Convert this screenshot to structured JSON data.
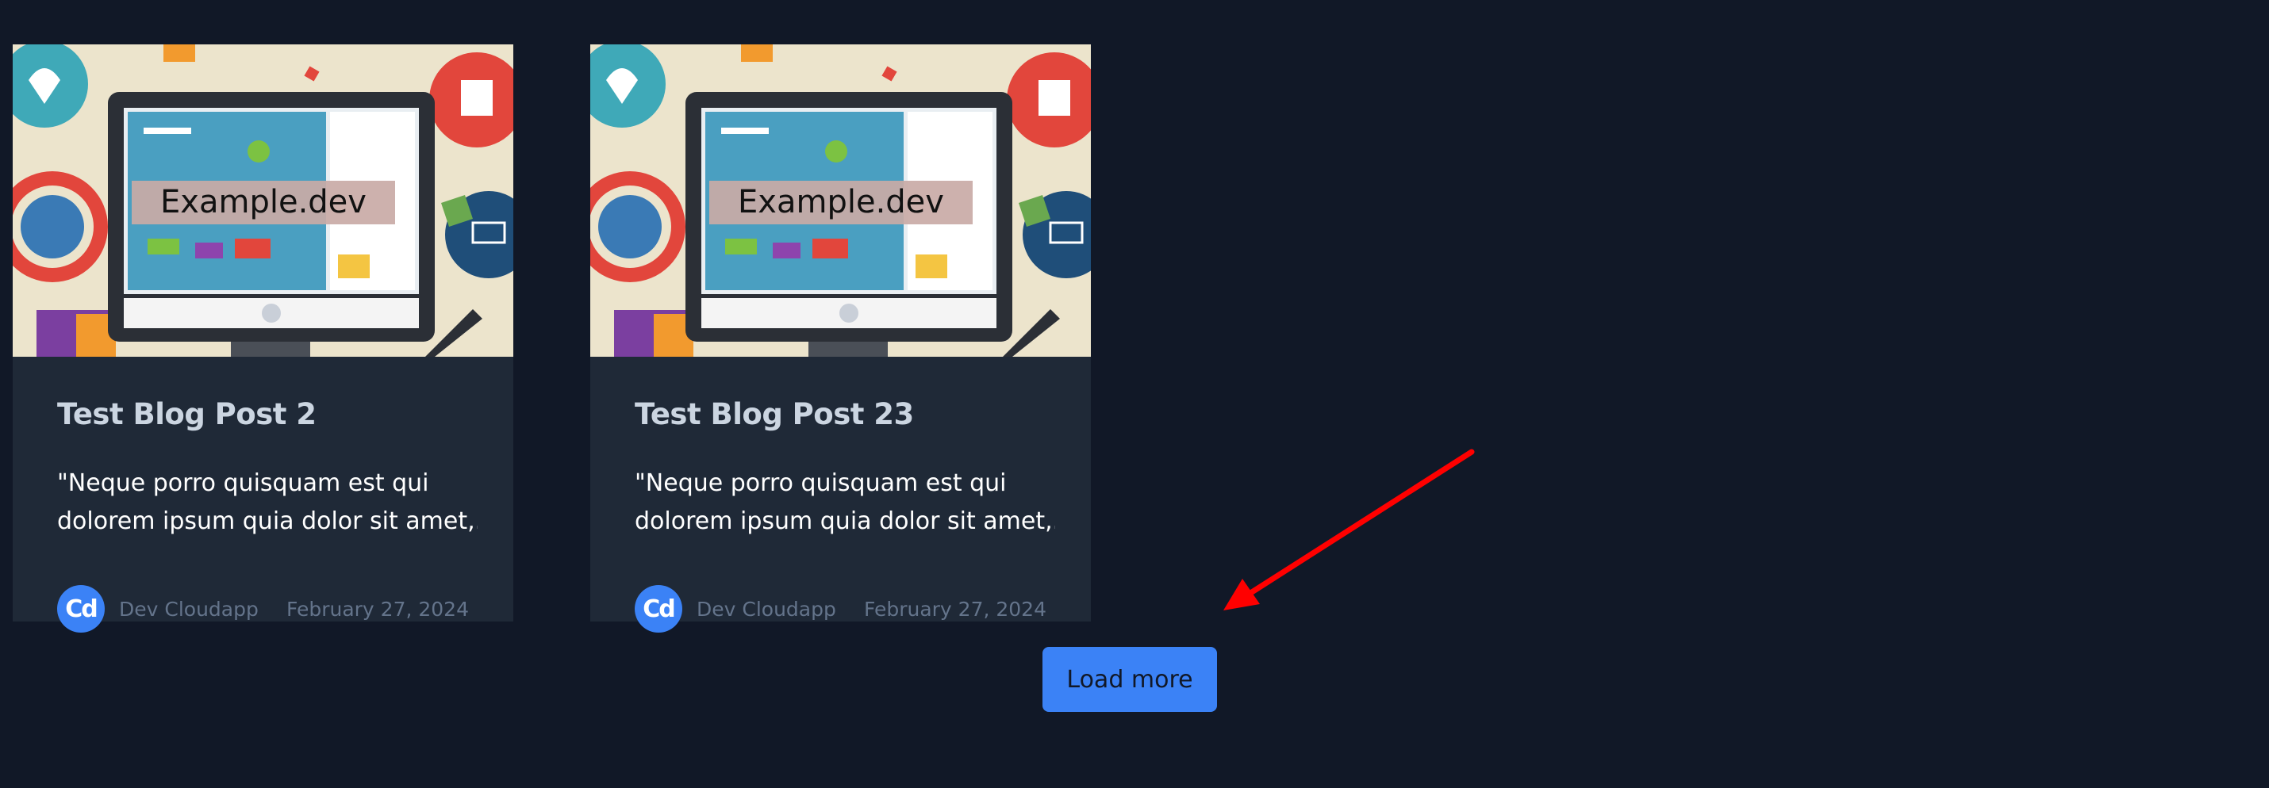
{
  "posts": [
    {
      "thumbnail_text": "Example.dev",
      "title": "Test Blog Post 2",
      "excerpt_line1": "\"Neque porro quisquam est qui",
      "excerpt_line2": "dolorem ipsum quia dolor sit amet,...",
      "author": "Dev Cloudapp",
      "avatar_text": "Cd",
      "date": "February 27, 2024"
    },
    {
      "thumbnail_text": "Example.dev",
      "title": "Test Blog Post 23",
      "excerpt_line1": "\"Neque porro quisquam est qui",
      "excerpt_line2": "dolorem ipsum quia dolor sit amet,...",
      "author": "Dev Cloudapp",
      "avatar_text": "Cd",
      "date": "February 27, 2024"
    }
  ],
  "load_more_label": "Load more",
  "colors": {
    "background": "#111827",
    "card": "#1f2937",
    "accent": "#3b82f6",
    "annotation_arrow": "#ff0000"
  }
}
